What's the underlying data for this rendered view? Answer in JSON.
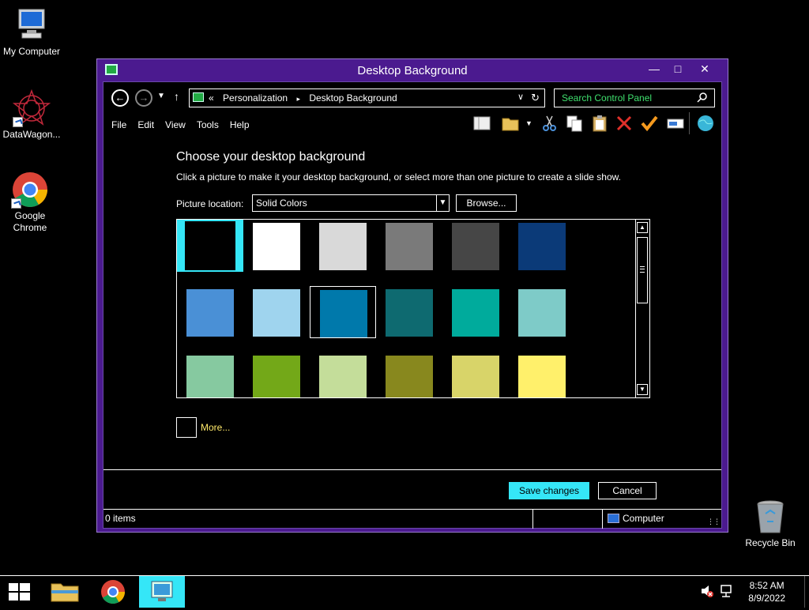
{
  "desktop": {
    "icons": [
      {
        "label": "My Computer"
      },
      {
        "label": "DataWagon..."
      },
      {
        "label": "Google\nChrome"
      },
      {
        "label": "Recycle Bin"
      }
    ]
  },
  "window": {
    "title": "Desktop Background",
    "controls": {
      "minimize": "—",
      "maximize": "□",
      "close": "✕"
    }
  },
  "address_bar": {
    "overflow": "«",
    "crumbs": [
      "Personalization",
      "▸",
      "Desktop Background"
    ],
    "search_placeholder": "Search Control Panel"
  },
  "menu": {
    "items": [
      "File",
      "Edit",
      "View",
      "Tools",
      "Help"
    ]
  },
  "content": {
    "heading": "Choose your desktop background",
    "subtext": "Click a picture to make it your desktop background, or select more than one picture to create a slide show.",
    "picture_location_label": "Picture location:",
    "picture_location_value": "Solid Colors",
    "browse_label": "Browse...",
    "more_label": "More..."
  },
  "swatches": [
    [
      "#000000",
      "#ffffff",
      "#d9d9d9",
      "#7a7a7a",
      "#464646",
      "#0b3a78"
    ],
    [
      "#4a90d6",
      "#9fd4ee",
      "#0079ab",
      "#0e6a70",
      "#00ab9c",
      "#7ecbc8"
    ],
    [
      "#86c9a0",
      "#73a818",
      "#c4dd9a",
      "#88881e",
      "#d8d469",
      "#fff06b"
    ]
  ],
  "colors": {
    "selected_highlight": "#35e6f7",
    "accent": "#4b1a8f"
  },
  "buttons": {
    "save": "Save changes",
    "cancel": "Cancel"
  },
  "statusbar": {
    "items_text": "0 items",
    "location_text": "Computer"
  },
  "taskbar": {
    "time": "8:52 AM",
    "date": "8/9/2022"
  }
}
